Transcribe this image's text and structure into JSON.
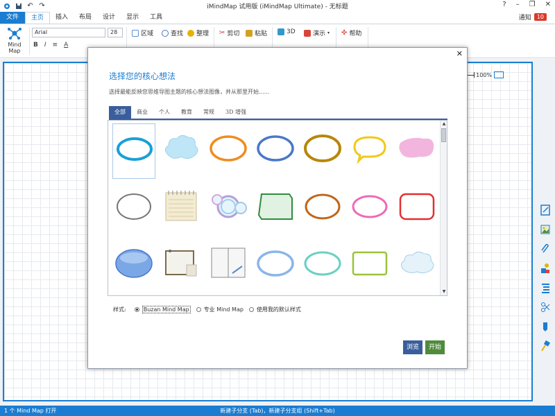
{
  "window": {
    "title": "iMindMap 试用版 (iMindMap Ultimate) - 无标题",
    "controls": [
      "?",
      "–",
      "❐",
      "✕"
    ]
  },
  "menu": {
    "tabs": [
      "文件",
      "主页",
      "插入",
      "布局",
      "设计",
      "显示",
      "工具"
    ],
    "active_tab": "主页",
    "notify_label": "通知",
    "notify_count": "10"
  },
  "ribbon": {
    "mindmap_label": "Mind Map",
    "font_name": "Arial",
    "font_size": "28",
    "format_buttons": [
      "B",
      "I",
      "≡",
      "A"
    ],
    "buttons": [
      {
        "label": "区域",
        "icon": "region-icon",
        "color": "#5b8fd6"
      },
      {
        "label": "查找",
        "icon": "search-icon",
        "color": "#4a7ac2"
      },
      {
        "label": "整理",
        "icon": "tidy-icon",
        "color": "#e6b200"
      },
      {
        "label": "剪切",
        "icon": "cut-icon",
        "color": "#cc3344"
      },
      {
        "label": "粘贴",
        "icon": "paste-icon",
        "color": "#d4a020"
      },
      {
        "label": "3D",
        "icon": "3d-icon",
        "color": "#3399cc"
      },
      {
        "label": "演示",
        "icon": "present-icon",
        "color": "#d9443a"
      },
      {
        "label": "帮助",
        "icon": "help-icon",
        "color": "#d9443a"
      }
    ]
  },
  "canvas": {
    "zoom": "100%"
  },
  "dialog": {
    "title": "选择您的核心想法",
    "subtitle": "选择最能反映您思维导图主题的核心想法图像，并从那里开始......",
    "categories": [
      "全部",
      "商业",
      "个人",
      "教育",
      "常规",
      "3D 增强"
    ],
    "active_category": "全部",
    "styles_label": "样式:",
    "style_options": [
      "Buzan Mind Map",
      "专业 Mind Map",
      "使用我的默认样式"
    ],
    "selected_style": "Buzan Mind Map",
    "browse_label": "浏览",
    "start_label": "开始",
    "close_label": "✕"
  },
  "status": {
    "left": "1 个 Mind Map 打开",
    "center": "新建子分支 (Tab)，新建子分支组 (Shift+Tab)"
  },
  "colors": {
    "accent": "#1a7dd1",
    "dialog_tab": "#3a5e9c",
    "start_button": "#4f8b3c"
  }
}
